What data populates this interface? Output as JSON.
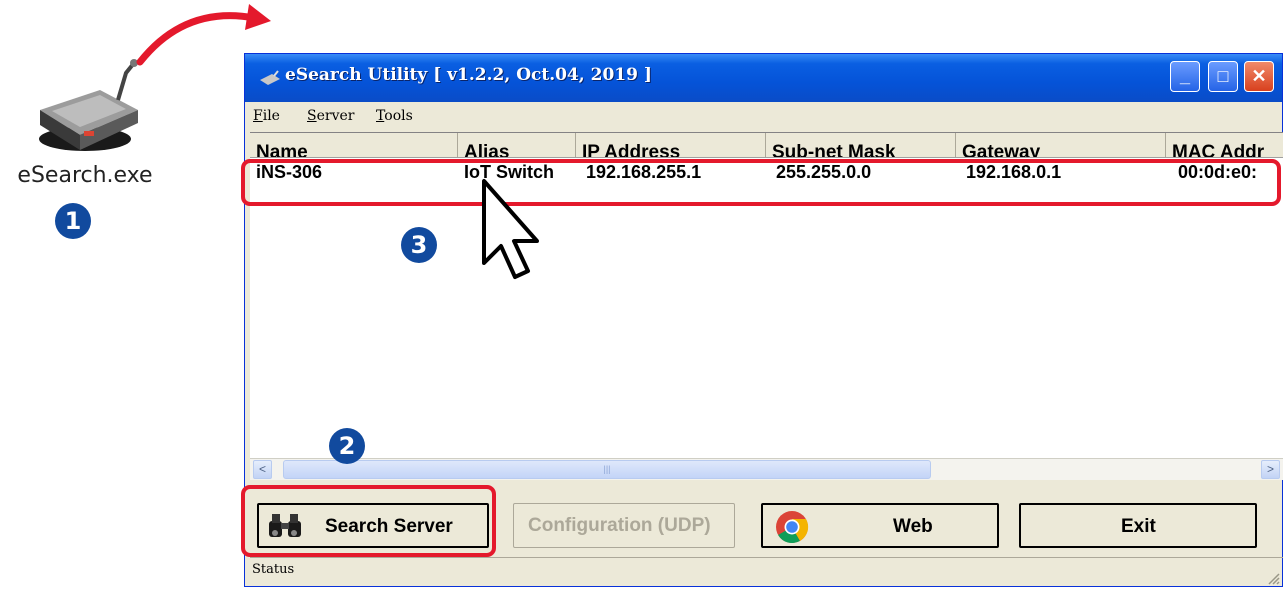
{
  "desktop": {
    "icon_label": "eSearch.exe",
    "icon_name": "esearch-app-icon"
  },
  "steps": {
    "one": "1",
    "two": "2",
    "three": "3"
  },
  "window": {
    "title": "eSearch Utility [ v1.2.2, Oct.04, 2019 ]",
    "controls": {
      "minimize": "_",
      "maximize": "□",
      "close": "✕"
    }
  },
  "menu": [
    "File",
    "Server",
    "Tools"
  ],
  "table": {
    "columns": [
      "Name",
      "Alias",
      "IP Address",
      "Sub-net Mask",
      "Gateway",
      "MAC Addr"
    ],
    "rows": [
      [
        "iNS-306",
        "IoT Switch",
        "192.168.255.1",
        "255.255.0.0",
        "192.168.0.1",
        "00:0d:e0:"
      ]
    ]
  },
  "scrollbar": {
    "left": "<",
    "right": ">",
    "grip": "|||"
  },
  "buttons": {
    "search": "Search Server",
    "config": "Configuration (UDP)",
    "web": "Web",
    "exit": "Exit"
  },
  "status": "Status",
  "colors": {
    "annotation": "#e4192c",
    "step_badge": "#114a9e",
    "title_bar": "#0553d8"
  }
}
